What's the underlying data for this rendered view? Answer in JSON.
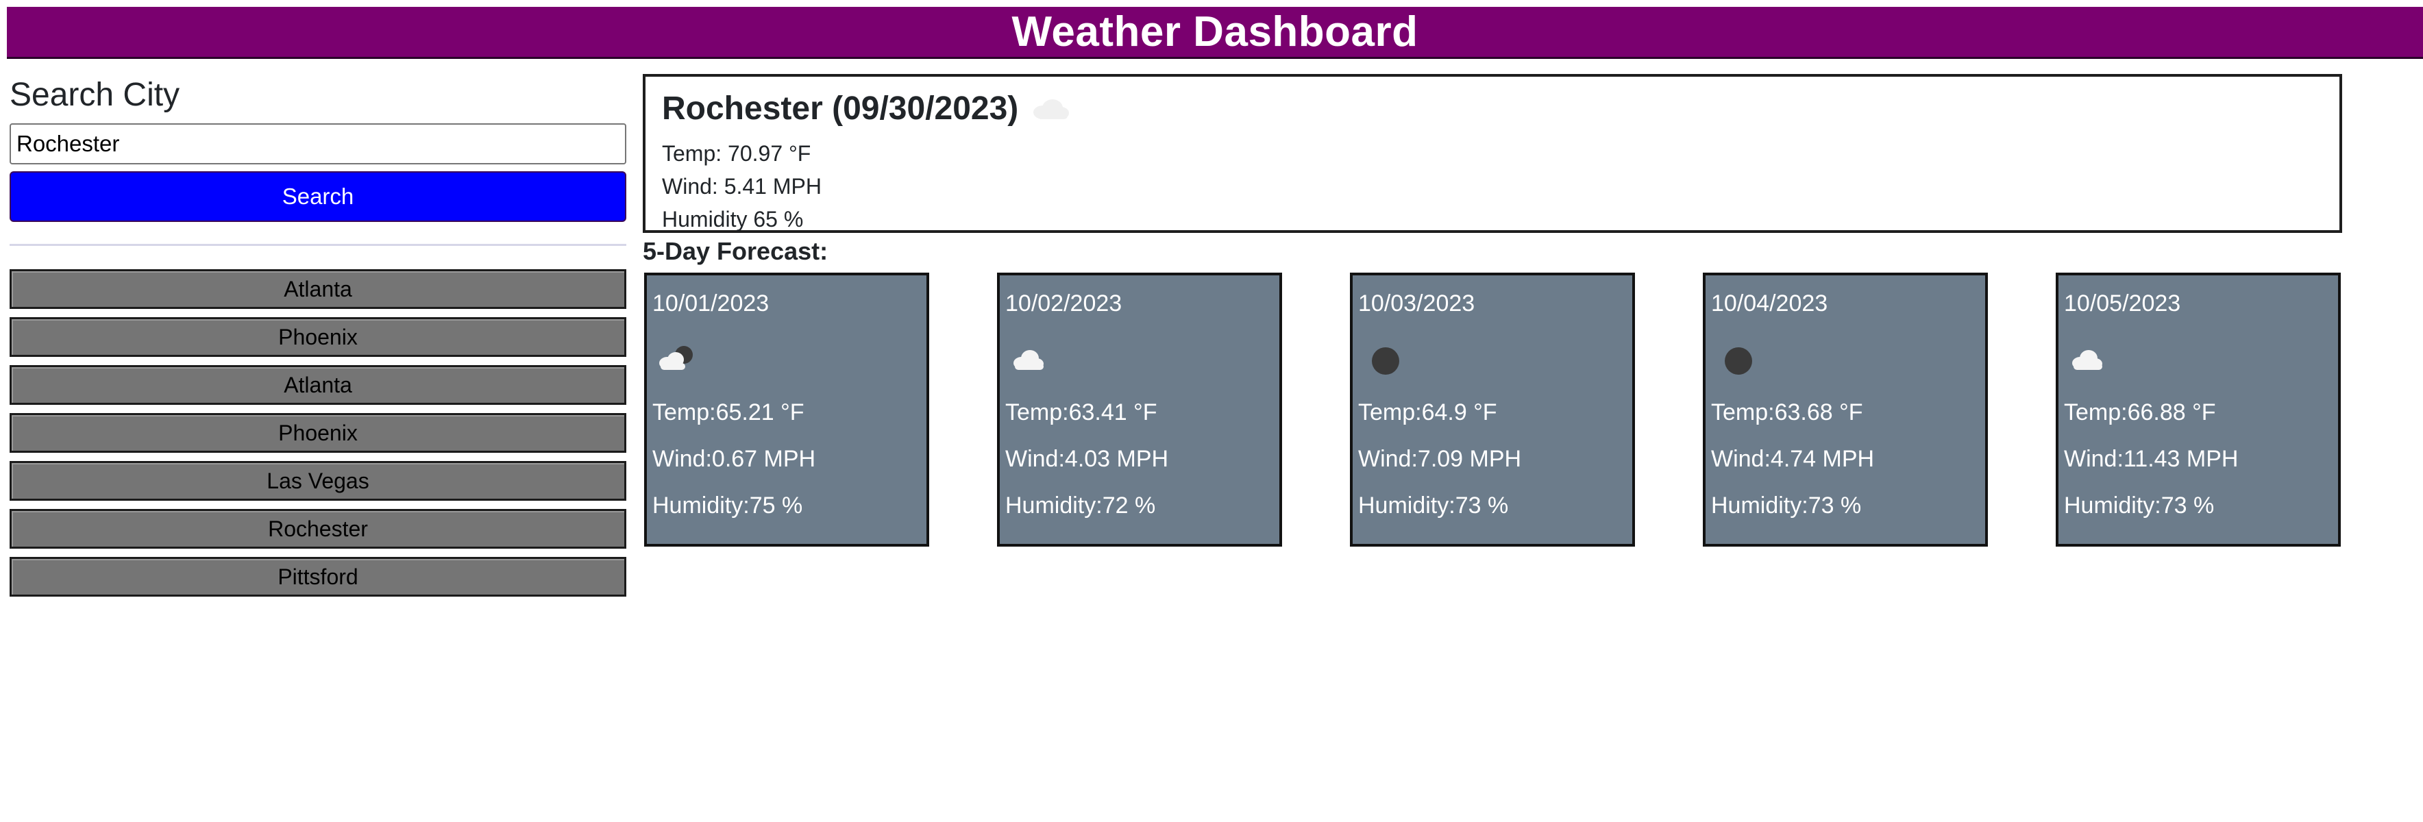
{
  "header": {
    "title": "Weather Dashboard",
    "background": "#7a006f"
  },
  "sidebar": {
    "heading": "Search City",
    "input_value": "Rochester",
    "button_label": "Search",
    "button_color": "#0000ff",
    "history": [
      "Atlanta",
      "Phoenix",
      "Atlanta",
      "Phoenix",
      "Las Vegas",
      "Rochester",
      "Pittsford"
    ]
  },
  "current": {
    "title": "Rochester (09/30/2023)",
    "icon": "cloud-icon",
    "temp": "Temp: 70.97 °F",
    "wind": "Wind: 5.41 MPH",
    "humidity": "Humidity 65 %"
  },
  "forecast": {
    "heading": "5-Day Forecast:",
    "card_color": "#6c7c8b",
    "days": [
      {
        "date": "10/01/2023",
        "icon": "cloud-moon-icon",
        "temp": "Temp:65.21 °F",
        "wind": "Wind:0.67 MPH",
        "humidity": "Humidity:75 %"
      },
      {
        "date": "10/02/2023",
        "icon": "cloud-icon",
        "temp": "Temp:63.41 °F",
        "wind": "Wind:4.03 MPH",
        "humidity": "Humidity:72 %"
      },
      {
        "date": "10/03/2023",
        "icon": "moon-icon",
        "temp": "Temp:64.9 °F",
        "wind": "Wind:7.09 MPH",
        "humidity": "Humidity:73 %"
      },
      {
        "date": "10/04/2023",
        "icon": "moon-icon",
        "temp": "Temp:63.68 °F",
        "wind": "Wind:4.74 MPH",
        "humidity": "Humidity:73 %"
      },
      {
        "date": "10/05/2023",
        "icon": "cloud-icon",
        "temp": "Temp:66.88 °F",
        "wind": "Wind:11.43 MPH",
        "humidity": "Humidity:73 %"
      }
    ]
  }
}
